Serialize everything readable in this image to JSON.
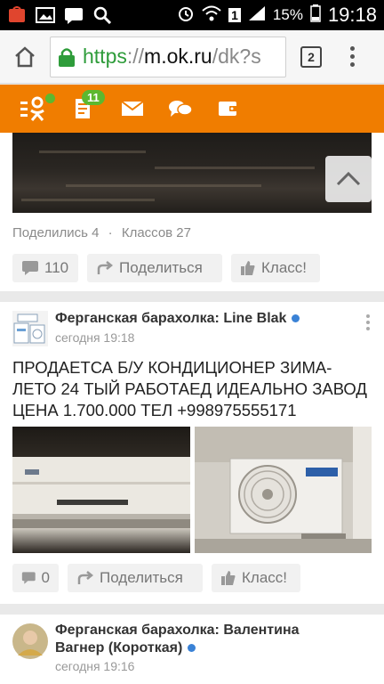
{
  "status_bar": {
    "battery": "15%",
    "time": "19:18",
    "sim": "1"
  },
  "browser": {
    "url_scheme": "https",
    "url_sep": "://",
    "url_host": "m.ok.ru",
    "url_path": "/dk?s",
    "tab_count": "2"
  },
  "ok_nav": {
    "notifications_badge": "11",
    "accent": "#f07d00"
  },
  "posts": [
    {
      "shares": "Поделились 4",
      "sep": "·",
      "likes_stat": "Классов 27",
      "comment_count": "110",
      "share_label": "Поделиться",
      "like_label": "Класс!"
    },
    {
      "author": "Ферганская барахолка: Line Blak",
      "time": "сегодня 19:18",
      "text": "ПРОДАЕТСА Б/У КОНДИЦИОНЕР ЗИМА-ЛЕТО 24 ТЫЙ РАБОТАЕД ИДЕАЛЬНО ЗАВОД ЦЕНА 1.700.000 ТЕЛ +998975555171",
      "comment_count": "0",
      "share_label": "Поделиться",
      "like_label": "Класс!"
    },
    {
      "author_line1": "Ферганская барахолка: Валентина",
      "author_line2": "Вагнер (Короткая)",
      "time": "сегодня 19:16"
    }
  ]
}
